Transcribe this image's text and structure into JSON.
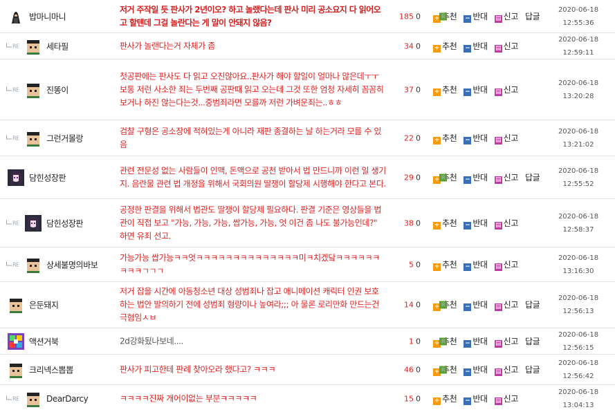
{
  "labels": {
    "recommend": "추천",
    "oppose": "반대",
    "report": "신고",
    "reply": "답글",
    "re": "RE"
  },
  "comments": [
    {
      "nick": "밥마니마니",
      "text": "저거 주작일 듯 판사가 2년이오? 하고 놀랬다는데 판사 미리 공소요지 다 읽어오고 할텐데 그걸 놀란다는 게 말이 안돼지 않음?",
      "up": "185",
      "down": "0",
      "date": "2020-06-18",
      "time": "12:55:36"
    },
    {
      "nick": "세타필",
      "text": "판사가 놀랜다는거 자체가 좀",
      "up": "34",
      "down": "0",
      "date": "2020-06-18",
      "time": "12:59:11"
    },
    {
      "nick": "진똥이",
      "text": "첫공판에는 판사도 다 읽고 오진않아요..판사가 해야 할일이 얼마나 많은데ㅜㅜ 보통 저런 사소한 죄는 두번째 공판때 읽고 오는데 그것 또한 엄청 자세히 꼼꼼히 보거나 하진 않는다는것...중범죄라면 모를까 저런 가벼운죄는..ㅎㅎ",
      "up": "37",
      "down": "0",
      "date": "2020-06-18",
      "time": "13:20:28"
    },
    {
      "nick": "그런거몰랑",
      "text": "검찰 구형은 공소장에 적혀있는게 아니라 재판 종결하는 날 하는거라 모를 수 있음",
      "up": "22",
      "down": "0",
      "date": "2020-06-18",
      "time": "13:21:02"
    },
    {
      "nick": "담힌성장판",
      "text": "관련 전문성 없는 사람들이 인맥, 돈맥으로 공천 받아서 법 만드니까 이런 일 생기지. 음란물 관련 법 개정을 위해서 국회의원 딸쟁이 할당제 시행해야 한다고 본다.",
      "up": "29",
      "down": "0",
      "date": "2020-06-18",
      "time": "12:55:52"
    },
    {
      "nick": "담힌성장판",
      "text": "공정한 판결을 위해서 법관도 딸쟁이 할당제 필요하다. 판결 기준은 영상들을 법관이 직접 보고 \"가능, 가능, 가능, 쌉가능, 가능, 엇 이건 좀 나도 불가능인데?\" 하면 유죄 선고.",
      "up": "38",
      "down": "0",
      "date": "2020-06-18",
      "time": "12:58:37"
    },
    {
      "nick": "상세불명의바보",
      "text": "가능가능 쌉가능ㅋㅋ엇ㅋㅋㅋㅋㅋㅋㅋㅋㅋㅋㅋㅋㅋㅋ미ㅋ치겠닼ㅋㅋㅋㅋㅋㅋㅋㅋㅋㄱㄱㄱ",
      "up": "5",
      "down": "0",
      "date": "2020-06-18",
      "time": "13:16:30"
    },
    {
      "nick": "은둔돼지",
      "text": "저거 잡을 시간에 아동청소년 대상 성범죄나 잡고 애니메이션 캐릭터 인권 보호하는 법안 발의하기 전에 성범죄 형량이나 높여라;;; 아 물론 로리만화 만드는건 극혐임ㅅㅂ",
      "up": "14",
      "down": "0",
      "date": "2020-06-18",
      "time": "12:56:13"
    },
    {
      "nick": "액션거북",
      "text": "2d강화됬나보네....",
      "up": "1",
      "down": "0",
      "date": "2020-06-18",
      "time": "12:56:15"
    },
    {
      "nick": "크리넥스뽑뽑",
      "text": "판사가 피고한테 판례 찾아오라 했다고? ㅋㅋㅋ",
      "up": "46",
      "down": "0",
      "date": "2020-06-18",
      "time": "12:56:42"
    },
    {
      "nick": "DearDarcy",
      "text": "ㅋㅋㅋㅋ진짜 개어이없는 부분ㅋㅋㅋㅋㅋ",
      "up": "15",
      "down": "0",
      "date": "2020-06-18",
      "time": "13:04:13"
    }
  ]
}
